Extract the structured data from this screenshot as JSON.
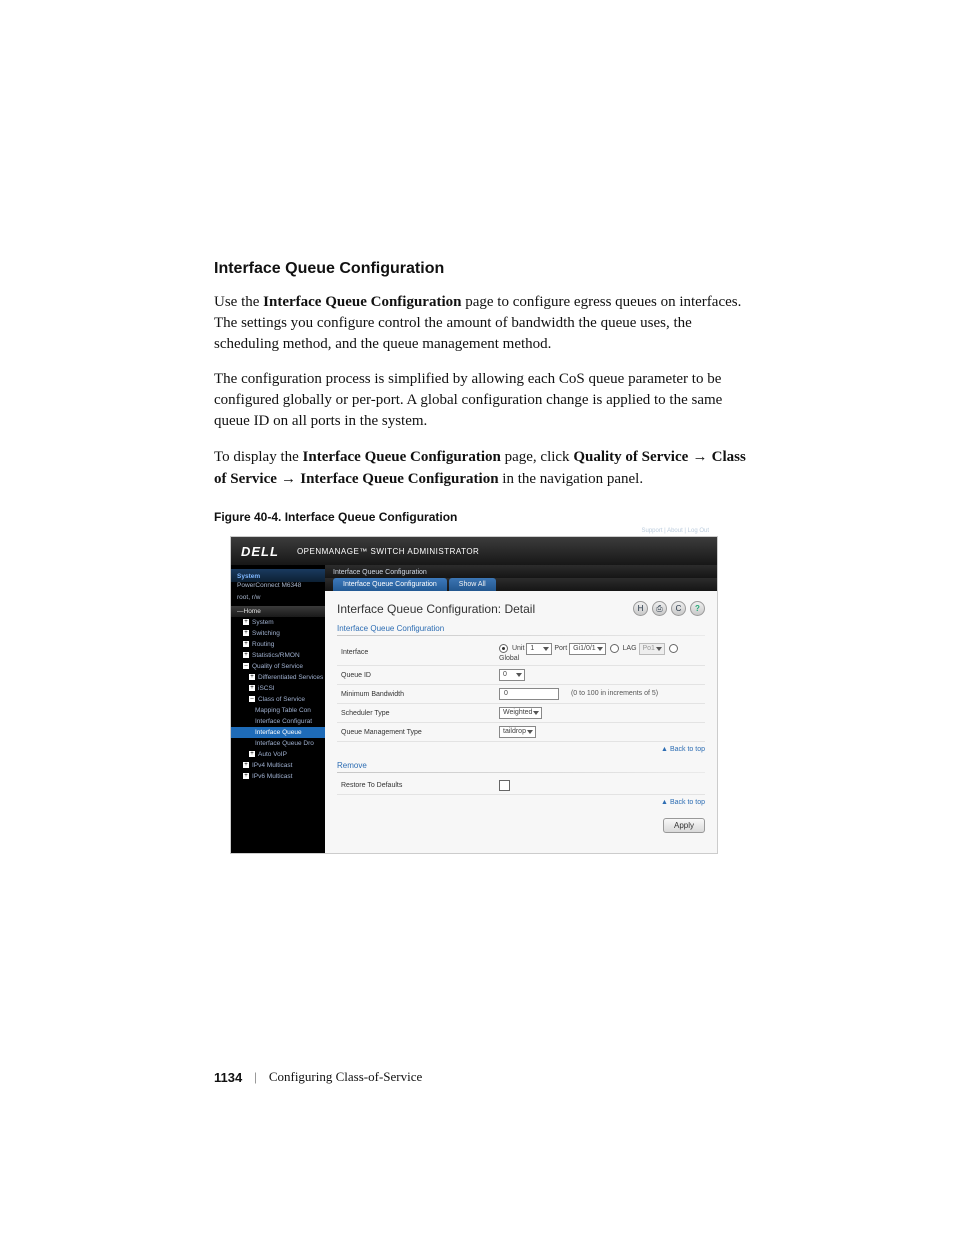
{
  "heading": "Interface Queue Configuration",
  "paragraphs": {
    "p1a": "Use the ",
    "p1b": "Interface Queue Configuration",
    "p1c": " page to configure egress queues on interfaces. The settings you configure control the amount of bandwidth the queue uses, the scheduling method, and the queue management method.",
    "p2": "The configuration process is simplified by allowing each CoS queue parameter to be configured globally or per-port. A global configuration change is applied to the same queue ID on all ports in the system.",
    "p3a": "To display the ",
    "p3b": "Interface Queue Configuration",
    "p3c": " page, click ",
    "p3d": "Quality of Service",
    "p3_arrow": " → ",
    "p3e": "Class of Service",
    "p3f": "Interface Queue Configuration",
    "p3g": " in the navigation panel."
  },
  "figure_caption": "Figure 40-4.    Interface Queue Configuration",
  "shot": {
    "top_links": "Support  |  About  |  Log Out",
    "brand": "DELL",
    "product": "OPENMANAGE™ SWITCH ADMINISTRATOR",
    "side": {
      "head": "System",
      "sub1": "PowerConnect M6348",
      "sub2": "root, r/w",
      "home": "Home",
      "items": [
        "System",
        "Switching",
        "Routing",
        "Statistics/RMON",
        "Quality of Service"
      ],
      "qos_children": [
        "Differentiated Services",
        "iSCSI",
        "Class of Service"
      ],
      "cos_children": [
        "Mapping Table Con",
        "Interface Configurat",
        "Interface Queue",
        "Interface Queue Dro"
      ],
      "auto_voip": "Auto VoIP",
      "ipv4": "IPv4 Multicast",
      "ipv6": "IPv6 Multicast"
    },
    "crumb": "Interface Queue Configuration",
    "tabs": {
      "t1": "Interface Queue Configuration",
      "t2": "Show All"
    },
    "detail_title": "Interface Queue Configuration: Detail",
    "icons": {
      "save": "H",
      "print": "⎙",
      "refresh": "C",
      "help": "?"
    },
    "section": "Interface Queue Configuration",
    "rows": {
      "interface": {
        "label": "Interface",
        "unit_lbl": "Unit",
        "unit_val": "1",
        "port_lbl": "Port",
        "port_val": "Gi1/0/1",
        "lag_lbl": "LAG",
        "lag_val": "Po1",
        "global_lbl": "Global"
      },
      "queue_id": {
        "label": "Queue ID",
        "value": "0"
      },
      "min_bw": {
        "label": "Minimum Bandwidth",
        "value": "0",
        "hint": "(0 to 100 in increments of 5)"
      },
      "sched": {
        "label": "Scheduler Type",
        "value": "Weighted"
      },
      "qmgmt": {
        "label": "Queue Management Type",
        "value": "taildrop"
      }
    },
    "remove_section": "Remove",
    "restore_label": "Restore To Defaults",
    "back_to_top": "Back to top",
    "apply": "Apply"
  },
  "footer": {
    "page": "1134",
    "sep": "|",
    "chapter": "Configuring Class-of-Service"
  }
}
